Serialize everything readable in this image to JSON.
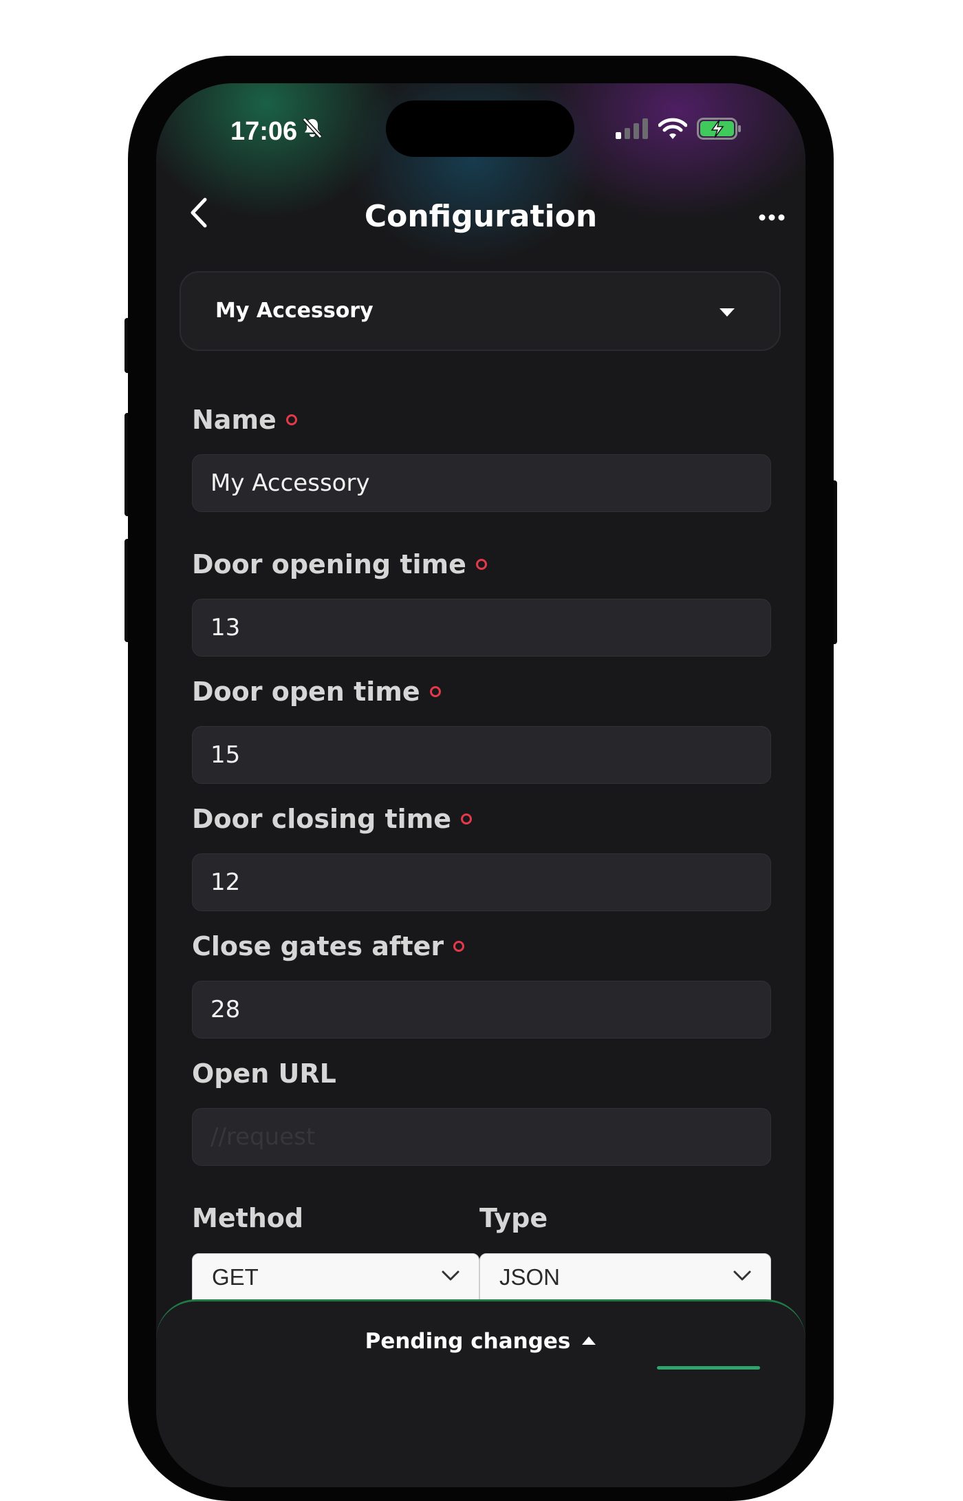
{
  "status_bar": {
    "time": "17:06",
    "icons": [
      "bell-slash-icon",
      "cellular-signal-icon",
      "wifi-icon",
      "battery-charging-icon"
    ]
  },
  "nav": {
    "title": "Configuration",
    "back_icon": "chevron-left-icon",
    "more_icon": "ellipsis-icon"
  },
  "accessory_selector": {
    "selected": "My Accessory",
    "icon": "caret-down-icon"
  },
  "form": {
    "name": {
      "label": "Name",
      "value": "My Accessory",
      "required": true
    },
    "door_opening_time": {
      "label": "Door opening time",
      "value": "13",
      "required": true
    },
    "door_open_time": {
      "label": "Door open time",
      "value": "15",
      "required": true
    },
    "door_closing_time": {
      "label": "Door closing time",
      "value": "12",
      "required": true
    },
    "close_gates_after": {
      "label": "Close gates after",
      "value": "28",
      "required": true
    },
    "open_url": {
      "label": "Open URL",
      "value": "",
      "placeholder": "//request"
    },
    "method": {
      "label": "Method",
      "value": "GET"
    },
    "type": {
      "label": "Type",
      "value": "JSON"
    }
  },
  "pending_changes": {
    "label": "Pending changes",
    "icon": "caret-up-icon"
  },
  "colors": {
    "background": "#18181a",
    "input_background": "#27272b",
    "required_indicator": "#e2394b",
    "accent_green": "#2ea56a",
    "label_text": "#d6d6d6"
  }
}
